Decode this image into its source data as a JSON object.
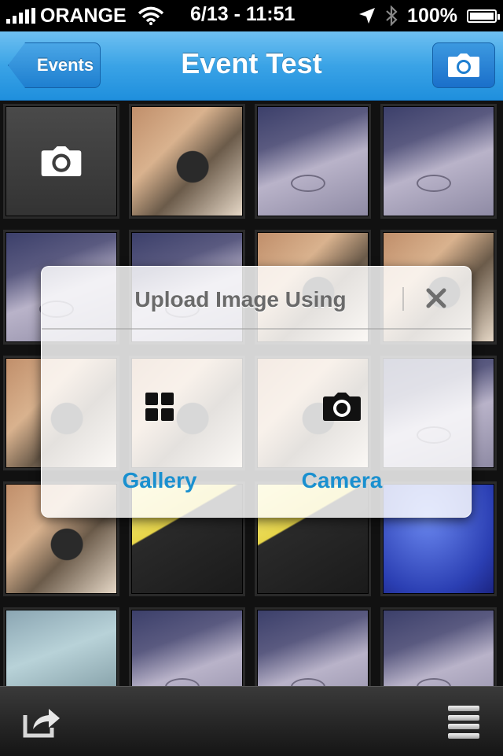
{
  "status_bar": {
    "carrier": "ORANGE",
    "time": "6/13 - 11:51",
    "battery": "100%",
    "battery_level": 1.0,
    "icons": [
      "signal-bars-icon",
      "wifi-icon",
      "location-arrow-icon",
      "bluetooth-icon",
      "battery-icon"
    ]
  },
  "navbar": {
    "title": "Event Test",
    "back_label": "Events",
    "right_button_icon": "camera-icon"
  },
  "grid": {
    "add_tile_icon": "camera-icon",
    "tile_subjects": [
      "add-photo",
      "person",
      "table",
      "table",
      "table",
      "table",
      "person",
      "person",
      "person",
      "person",
      "person",
      "table",
      "person",
      "yellow",
      "yellow",
      "blue",
      "towel",
      "table",
      "table",
      "table"
    ]
  },
  "modal": {
    "title": "Upload Image Using",
    "close_icon": "close-icon",
    "options": [
      {
        "label": "Gallery",
        "icon": "grid-icon"
      },
      {
        "label": "Camera",
        "icon": "camera-icon"
      }
    ]
  },
  "toolbar": {
    "left_icon": "share-icon",
    "right_icon": "menu-icon"
  },
  "colors": {
    "nav_blue": "#3aa3e6",
    "option_label": "#1a90cf"
  }
}
